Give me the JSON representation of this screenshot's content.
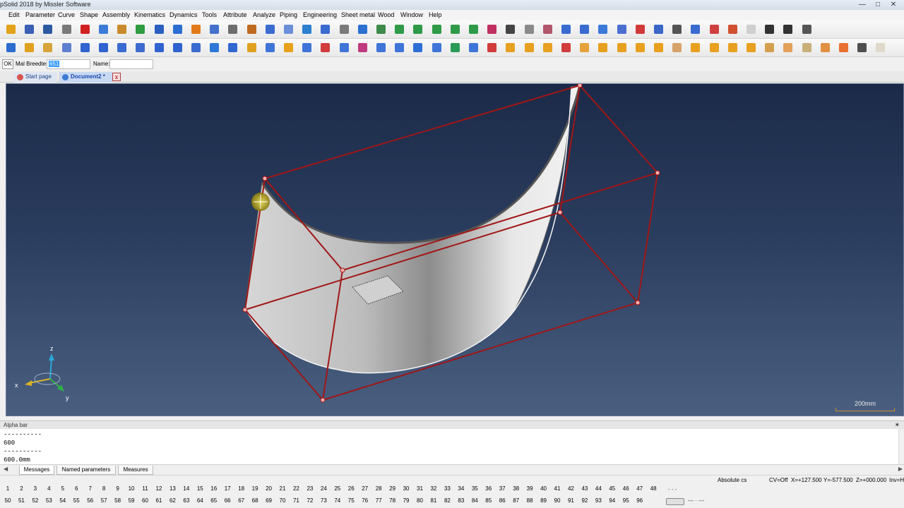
{
  "window": {
    "title": "pSolid 2018 by Missler Software"
  },
  "menu": [
    "Edit",
    "Parameter",
    "Curve",
    "Shape",
    "Assembly",
    "Kinematics",
    "Dynamics",
    "Tools",
    "Attribute",
    "Analyze",
    "Piping",
    "Engineering",
    "Sheet metal",
    "Wood",
    "Window",
    "Help"
  ],
  "toolbar1": {
    "icons": [
      "new-icon",
      "save-icon",
      "export-icon",
      "print-icon",
      "delete-icon",
      "undo-icon",
      "eraser-icon",
      "refresh-icon",
      "search-icon",
      "tools-icon",
      "hammer-icon",
      "gears-icon",
      "hierarchy-icon",
      "paint-icon",
      "cursor-icon",
      "select-icon",
      "node-icon",
      "grid-icon",
      "magnet-icon",
      "zoom-icon",
      "fit-icon",
      "layer-icon",
      "layer2-icon",
      "layer3-icon",
      "layer4-icon",
      "layer5-icon",
      "color-icon",
      "camera-icon",
      "render-icon",
      "eye-icon",
      "view-icon",
      "move-icon",
      "section-icon",
      "explode-icon",
      "measure-icon",
      "attach-icon",
      "mesh-icon",
      "light-icon",
      "sphere-icon",
      "pin-icon",
      "sketch-icon",
      "point-icon",
      "line-icon",
      "hatch-icon"
    ],
    "icon_colors": [
      "#e3a21a",
      "#3a5fb5",
      "#2c5aa0",
      "#7a7a7a",
      "#d11f1f",
      "#3b7bd6",
      "#c98a2b",
      "#2e9c3f",
      "#2b5fc0",
      "#2b6ed1",
      "#e07a1a",
      "#4470cc",
      "#6c6c6c",
      "#c06a20",
      "#3a6bd0",
      "#6b8fd8",
      "#2d7fd0",
      "#3a6bd0",
      "#7a7a7a",
      "#2b6fd0",
      "#3d8a4a",
      "#2f9a47",
      "#2f9a47",
      "#2f9a47",
      "#2f9a47",
      "#2f9a47",
      "#c03060",
      "#444",
      "#8a8a8a",
      "#b0566d",
      "#3a6bd0",
      "#3a6bd0",
      "#3b7ad8",
      "#4b6fd1",
      "#d23a3a",
      "#3967c8",
      "#555",
      "#3a6bd0",
      "#d04040",
      "#d05030",
      "#cfcfcf",
      "#333",
      "#333",
      "#555"
    ]
  },
  "toolbar2": {
    "icons": [
      "pencil-icon",
      "brush-icon",
      "star-icon",
      "polygon-icon",
      "spline-icon",
      "circle-icon",
      "arc-icon",
      "dimension-icon",
      "line-tool-icon",
      "arch-icon",
      "cube-icon",
      "sweep-icon",
      "extrude-icon",
      "box-icon",
      "box2-icon",
      "box3-icon",
      "box4-icon",
      "box5-icon",
      "box6-icon",
      "lens-icon",
      "plate-icon",
      "shell-icon",
      "shell2-icon",
      "shell3-icon",
      "shell4-icon",
      "fillet-icon",
      "chamfer-icon",
      "axis-icon",
      "part-icon",
      "part2-icon",
      "part3-icon",
      "part4-icon",
      "part5-icon",
      "part6-icon",
      "part7-icon",
      "part8-icon",
      "part9-icon",
      "part10-icon",
      "part11-icon",
      "part12-icon",
      "part13-icon",
      "part14-icon",
      "part15-icon",
      "part16-icon",
      "part17-icon",
      "part18-icon",
      "part19-icon",
      "part20-icon"
    ],
    "icon_colors": [
      "#2c6cd0",
      "#e0a020",
      "#d8a33a",
      "#5f7fcf",
      "#2f63cf",
      "#2f63cf",
      "#3a6bd0",
      "#3d6bd0",
      "#2f63cf",
      "#2f63cf",
      "#3a6bd0",
      "#2d77d8",
      "#3068d0",
      "#e0a020",
      "#3f75d8",
      "#e6a21a",
      "#3f75d8",
      "#d13c3c",
      "#3f75d8",
      "#c03a7f",
      "#3f75d8",
      "#3f75d8",
      "#2e6fd6",
      "#3f75d8",
      "#2c9b58",
      "#3f75d8",
      "#d13c3c",
      "#e8a020",
      "#e8a020",
      "#e8a020",
      "#d13c3c",
      "#e6a23a",
      "#e8a020",
      "#e8a020",
      "#e8a020",
      "#e8a020",
      "#d6a26a",
      "#e8a020",
      "#e8a020",
      "#e8a020",
      "#e8a020",
      "#d4a050",
      "#e3a15a",
      "#c8b078",
      "#e09040",
      "#e87030",
      "#4f4f4f",
      "#e0d8c8"
    ]
  },
  "param_bar": {
    "ok_label": "OK",
    "mal_label": "Mal Breedte=",
    "mal_value": "651",
    "name_label": "Name:",
    "name_value": ""
  },
  "tabs": {
    "start": "Start page",
    "document": "Document2 *",
    "close": "x"
  },
  "viewport": {
    "axis_z": "z",
    "axis_x": "x",
    "axis_y": "y",
    "scale_label": "200mm",
    "background_top": "#1b2a48",
    "background_bottom": "#4a5f80",
    "frame_color": "#a01616",
    "surface_color": "#c9c9c9"
  },
  "alpha_bar": {
    "title": "Alpha bar",
    "pin": "✶",
    "lines": [
      "----------",
      "600",
      "----------",
      "600.0mm"
    ]
  },
  "bottom_tabs": [
    "Messages",
    "Named parameters",
    "Measures"
  ],
  "status": {
    "cs": "Absolute cs",
    "cv": "CV=Off",
    "x": "X=+127.500",
    "y": "Y=-577.500",
    "z": "Z=+000.000",
    "inv": "Inv=H"
  },
  "number_keys_row1": [
    "1",
    "2",
    "3",
    "4",
    "5",
    "6",
    "7",
    "8",
    "9",
    "10",
    "11",
    "12",
    "13",
    "14",
    "15",
    "16",
    "17",
    "18",
    "19",
    "20",
    "21",
    "22",
    "23",
    "24",
    "25",
    "26",
    "27",
    "28",
    "29",
    "30",
    "31",
    "32",
    "33",
    "34",
    "35",
    "36",
    "37",
    "38",
    "39",
    "40",
    "41",
    "42",
    "43",
    "44",
    "45",
    "46",
    "47",
    "48"
  ],
  "number_keys_row2": [
    "50",
    "51",
    "52",
    "53",
    "54",
    "55",
    "56",
    "57",
    "58",
    "59",
    "60",
    "61",
    "62",
    "63",
    "64",
    "65",
    "66",
    "67",
    "68",
    "69",
    "70",
    "71",
    "72",
    "73",
    "74",
    "75",
    "76",
    "77",
    "78",
    "79",
    "80",
    "81",
    "82",
    "83",
    "84",
    "85",
    "86",
    "87",
    "88",
    "89",
    "90",
    "91",
    "92",
    "93",
    "94",
    "95",
    "96"
  ]
}
